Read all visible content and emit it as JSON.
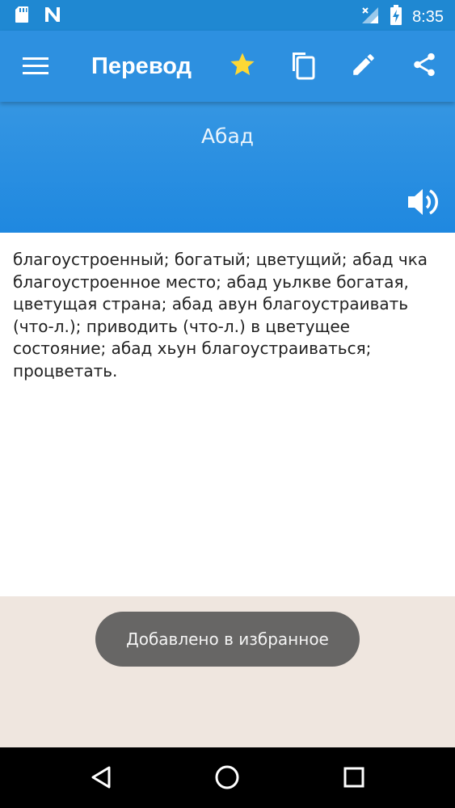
{
  "status_bar": {
    "time": "8:35",
    "icons": [
      "sd-card-icon",
      "n-notification-icon",
      "signal-icon",
      "battery-charging-icon"
    ]
  },
  "app_bar": {
    "title": "Перевод",
    "actions": [
      "star-icon",
      "copy-icon",
      "edit-icon",
      "share-icon"
    ],
    "star_color": "#fdd835"
  },
  "hero": {
    "word": "Абад",
    "speaker_icon": "volume-icon"
  },
  "translation": {
    "text": "благоустроенный; богатый; цветущий; абад чка благоустроенное место; абад уьлкве богатая, цветущая страна; абад авун благоустраивать (что-л.); приводить (что-л.) в цветущее состояние; абад хьун благоустраиваться; процветать."
  },
  "toast": {
    "message": "Добавлено в избранное"
  },
  "nav_bar": {
    "buttons": [
      "back-icon",
      "home-icon",
      "recents-icon"
    ]
  },
  "colors": {
    "status_bar": "#1f88d2",
    "app_bar": "#2d90e0",
    "hero": "#2690e0",
    "lower_background": "#efe6df",
    "toast": "#676665"
  }
}
